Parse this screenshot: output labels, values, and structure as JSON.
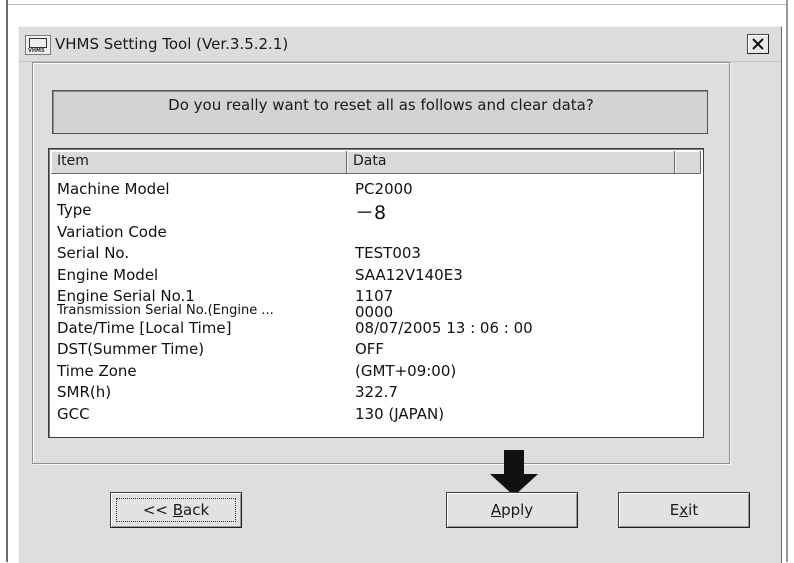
{
  "window": {
    "title": "VHMS Setting Tool  (Ver.3.5.2.1)",
    "icon": "vhms-app-icon",
    "icon_text": "VHMS"
  },
  "dialog": {
    "prompt": "Do you really want to reset all as follows and clear data?"
  },
  "table": {
    "columns": [
      "Item",
      "Data"
    ],
    "rows": [
      {
        "item": "Machine Model",
        "data": "PC2000"
      },
      {
        "item": "Type",
        "data": "－8"
      },
      {
        "item": "Variation Code",
        "data": ""
      },
      {
        "item": "Serial No.",
        "data": "TEST003"
      },
      {
        "item": "Engine Model",
        "data": "SAA12V140E3"
      },
      {
        "item": "Engine Serial No.1",
        "data": "1107"
      },
      {
        "item": "Transmission Serial No.(Engine ...",
        "data": "0000"
      },
      {
        "item": "Date/Time [Local Time]",
        "data": "08/07/2005 13 : 06 : 00"
      },
      {
        "item": "DST(Summer Time)",
        "data": "OFF"
      },
      {
        "item": "Time Zone",
        "data": "(GMT+09:00)"
      },
      {
        "item": "SMR(h)",
        "data": "322.7"
      },
      {
        "item": "GCC",
        "data": "130 (JAPAN)"
      }
    ]
  },
  "buttons": {
    "back": {
      "prefix": "<< ",
      "accel": "B",
      "rest": "ack"
    },
    "apply": {
      "accel": "A",
      "rest": "pply"
    },
    "exit": {
      "pre": "E",
      "accel": "x",
      "rest": "it"
    }
  },
  "annotation": {
    "arrow_icon": "down-arrow-icon",
    "color": "#111111"
  }
}
